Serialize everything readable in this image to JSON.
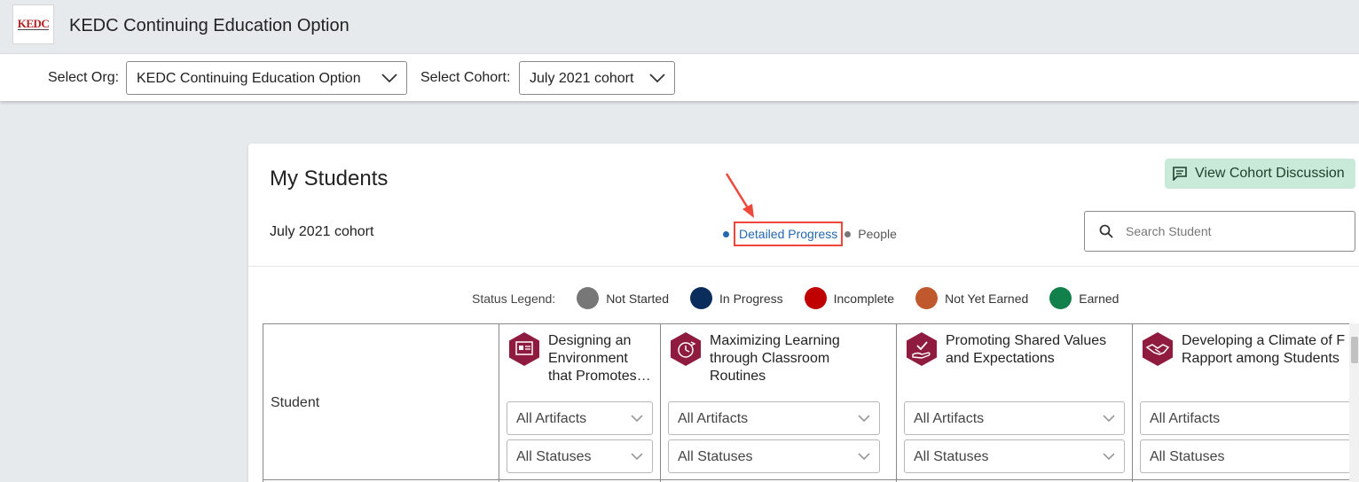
{
  "header": {
    "logo_text": "KEDC",
    "app_title": "KEDC Continuing Education Option"
  },
  "filters": {
    "org_label": "Select Org:",
    "org_value": "KEDC Continuing Education Option",
    "cohort_label": "Select Cohort:",
    "cohort_value": "July 2021 cohort"
  },
  "card": {
    "title": "My Students",
    "cohort": "July 2021 cohort",
    "discussion_button": "View Cohort Discussion",
    "view_tabs": {
      "detailed": "Detailed Progress",
      "people": "People"
    },
    "search_placeholder": "Search Student"
  },
  "legend": {
    "title": "Status Legend:",
    "items": [
      {
        "label": "Not Started",
        "color": "#777777"
      },
      {
        "label": "In Progress",
        "color": "#0b2d5b"
      },
      {
        "label": "Incomplete",
        "color": "#c00000"
      },
      {
        "label": "Not Yet Earned",
        "color": "#c0582e"
      },
      {
        "label": "Earned",
        "color": "#11804a"
      }
    ]
  },
  "table": {
    "student_header": "Student",
    "columns": [
      {
        "title_lines": [
          "Designing an",
          "Environment",
          "that Promotes…"
        ],
        "icon": "classroom-board-icon",
        "artifacts": "All Artifacts",
        "statuses": "All Statuses"
      },
      {
        "title_lines": [
          "Maximizing Learning",
          "through Classroom",
          "Routines"
        ],
        "icon": "routine-clock-icon",
        "artifacts": "All Artifacts",
        "statuses": "All Statuses"
      },
      {
        "title_lines": [
          "Promoting Shared Values",
          "and Expectations"
        ],
        "icon": "hand-check-icon",
        "artifacts": "All Artifacts",
        "statuses": "All Statuses"
      },
      {
        "title_lines": [
          "Developing a Climate of F",
          "Rapport among Students"
        ],
        "icon": "handshake-icon",
        "artifacts": "All Artifacts",
        "statuses": "All Statuses"
      }
    ]
  },
  "colors": {
    "accent": "#2568b0",
    "badge": "#8f1c3f",
    "discussion_bg": "#c9ead9",
    "highlight": "#f0473b"
  }
}
